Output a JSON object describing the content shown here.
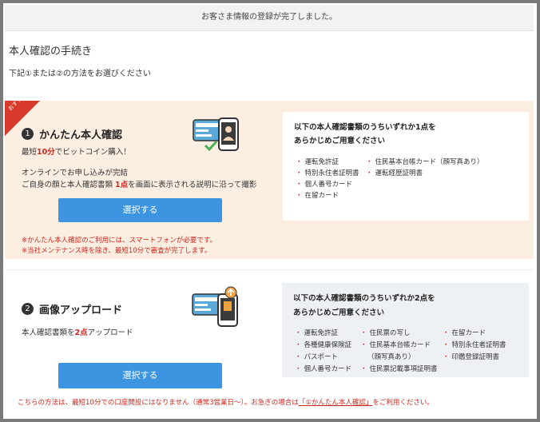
{
  "notice": "お客さま情報の登録が完了しました。",
  "page_title": "本人確認の手続き",
  "page_subtitle": "下記①または②の方法をお選びください",
  "option1": {
    "ribbon": "おすすめ",
    "number": "1",
    "heading": "かんたん本人確認",
    "tag_prefix": "最短",
    "tag_highlight": "10分",
    "tag_suffix": "でビットコイン購入！",
    "desc1": "オンラインでお申し込みが完結",
    "desc2_prefix": "ご自身の顔と本人確認書類",
    "desc2_highlight": "1点",
    "desc2_suffix": "を画面に表示される説明に沿って撮影",
    "button": "選択する",
    "note1": "※かんたん本人確認のご利用には、スマートフォンが必要です。",
    "note2": "※当社メンテナンス時を除き、最短10分で審査が完了します。",
    "docs_title1": "以下の本人確認書類のうちいずれか1点を",
    "docs_title2": "あらかじめご用意ください",
    "docs": [
      "運転免許証",
      "特別永住者証明書",
      "個人番号カード",
      "在留カード",
      "住民基本台帳カード（顔写真あり）",
      "運転経歴証明書"
    ]
  },
  "option2": {
    "number": "2",
    "heading": "画像アップロード",
    "desc_prefix": "本人確認書類を",
    "desc_highlight": "2点",
    "desc_suffix": "アップロード",
    "button": "選択する",
    "docs_title1": "以下の本人確認書類のうちいずれか2点を",
    "docs_title2": "あらかじめご用意ください",
    "docs": [
      "運転免許証",
      "各種健康保険証",
      "パスポート",
      "個人番号カード",
      "住民票の写し",
      "住民基本台帳カード",
      "（顔写真あり）",
      "住民票記載事項証明書",
      "在留カード",
      "特別永住者証明書",
      "印鑑登録証明書"
    ]
  },
  "footer": {
    "prefix": "こちらの方法は、最短10分での口座開設にはなりません（通常3営業日〜）。お急ぎの場合は",
    "link": "「①かんたん本人確認」",
    "suffix": "をご利用ください。"
  }
}
